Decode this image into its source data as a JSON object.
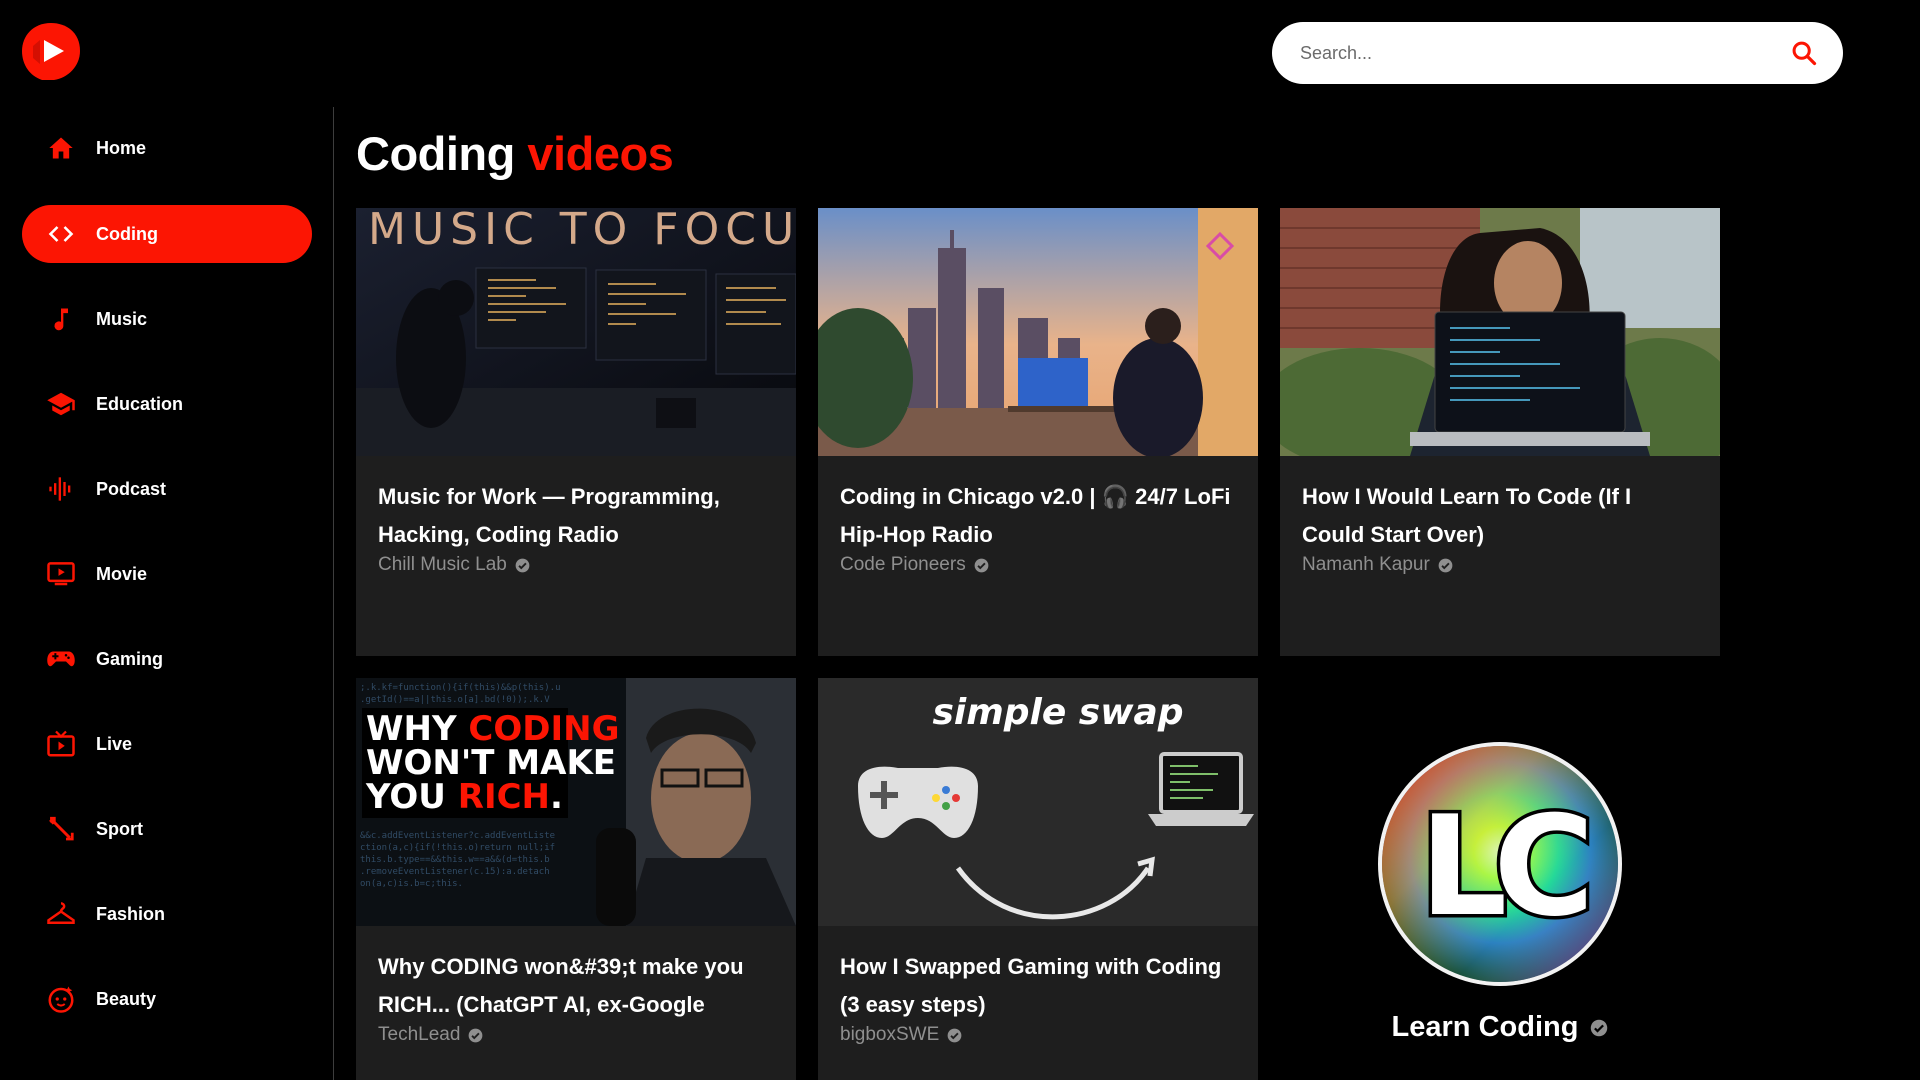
{
  "search": {
    "placeholder": "Search..."
  },
  "sidebar": {
    "items": [
      {
        "label": "Home",
        "icon": "home-icon"
      },
      {
        "label": "Coding",
        "icon": "code-icon",
        "active": true
      },
      {
        "label": "Music",
        "icon": "music-note-icon"
      },
      {
        "label": "Education",
        "icon": "graduation-cap-icon"
      },
      {
        "label": "Podcast",
        "icon": "podcast-icon"
      },
      {
        "label": "Movie",
        "icon": "ondemand-video-icon"
      },
      {
        "label": "Gaming",
        "icon": "gamepad-icon"
      },
      {
        "label": "Live",
        "icon": "live-tv-icon"
      },
      {
        "label": "Sport",
        "icon": "fitness-icon"
      },
      {
        "label": "Fashion",
        "icon": "checkroom-icon"
      },
      {
        "label": "Beauty",
        "icon": "face-retouching-icon"
      }
    ]
  },
  "main": {
    "title": "Coding",
    "title_accent": "videos"
  },
  "videos": [
    {
      "title": "Music for Work — Programming, Hacking, Coding Radio",
      "channel": "Chill Music Lab",
      "thumb_text": "MUSIC TO FOCU"
    },
    {
      "title": "Coding in Chicago v2.0 | 🎧 24/7 LoFi Hip-Hop Radio",
      "channel": "Code Pioneers"
    },
    {
      "title": "How I Would Learn To Code (If I Could Start Over)",
      "channel": "Namanh Kapur"
    },
    {
      "title": "Why CODING won&#39;t make you RICH... (ChatGPT AI, ex-Google",
      "channel": "TechLead",
      "thumb_text": [
        "WHY ",
        "CODING",
        "WON'T MAKE",
        "YOU ",
        "RICH",
        "."
      ]
    },
    {
      "title": "How I Swapped Gaming with Coding (3 easy steps)",
      "channel": "bigboxSWE",
      "thumb_text": "simple swap"
    }
  ],
  "channel_card": {
    "name": "Learn Coding",
    "avatar_text": "LC"
  },
  "colors": {
    "accent": "#fc1503",
    "card_bg": "#1e1e1e",
    "muted_text": "#8f8f8f"
  }
}
